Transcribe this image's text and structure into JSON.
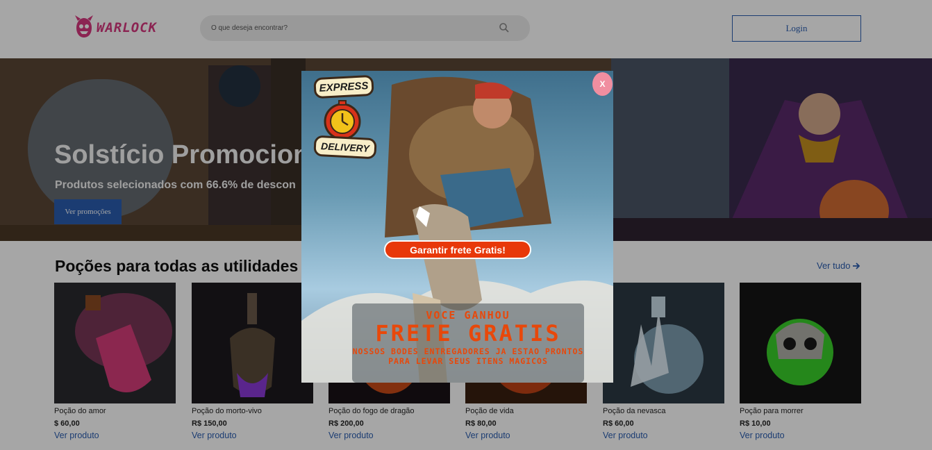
{
  "header": {
    "logo_text": "WARLOCK",
    "search_placeholder": "O que deseja encontrar?",
    "login_label": "Login"
  },
  "banner": {
    "title": "Solstício Promocion",
    "subtitle": "Produtos selecionados com 66.6% de descon",
    "button_label": "Ver promoções"
  },
  "products": {
    "title": "Poções para todas as utilidades",
    "see_all_label": "Ver tudo",
    "items": [
      {
        "name": "Poção do amor",
        "price": "$ 60,00",
        "link": "Ver produto"
      },
      {
        "name": "Poção do morto-vivo",
        "price": "R$ 150,00",
        "link": "Ver produto"
      },
      {
        "name": "Poção do fogo de dragão",
        "price": "R$ 200,00",
        "link": "Ver produto"
      },
      {
        "name": "Poção de vida",
        "price": "R$ 80,00",
        "link": "Ver produto"
      },
      {
        "name": "Poção da nevasca",
        "price": "R$ 60,00",
        "link": "Ver produto"
      },
      {
        "name": "Poção para morrer",
        "price": "R$ 10,00",
        "link": "Ver produto"
      }
    ]
  },
  "modal": {
    "close_label": "X",
    "badge_top": "EXPRESS",
    "badge_bottom": "DELIVERY",
    "cta_label": "Garantir frete Gratis!",
    "promo_line1": "VOCE GANHOU",
    "promo_line2": "FRETE GRATIS",
    "promo_line3": "NOSSOS BODES ENTREGADORES JA ESTAO PRONTOS  PARA LEVAR SEUS ITENS MAGICOS"
  },
  "colors": {
    "accent": "#2a5db0",
    "logo": "#d6387e",
    "cta": "#e8380a"
  }
}
